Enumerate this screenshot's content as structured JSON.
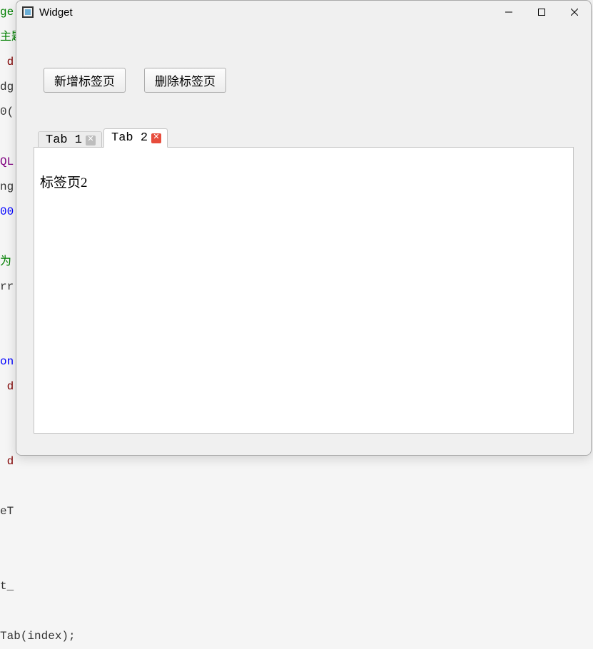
{
  "bg_code_fragments": [
    {
      "c": "g",
      "t": "ge"
    },
    {
      "c": "g",
      "t": "主题"
    },
    {
      "c": "r",
      "t": " d"
    },
    {
      "c": "",
      "t": "dg"
    },
    {
      "c": "",
      "t": "0("
    },
    {
      "c": "",
      "t": ""
    },
    {
      "c": "p",
      "t": "QL"
    },
    {
      "c": "",
      "t": "ng"
    },
    {
      "c": "b",
      "t": "00"
    },
    {
      "c": "",
      "t": ""
    },
    {
      "c": "g",
      "t": "为"
    },
    {
      "c": "",
      "t": "rr"
    },
    {
      "c": "",
      "t": ""
    },
    {
      "c": "",
      "t": ""
    },
    {
      "c": "b",
      "t": "on"
    },
    {
      "c": "r",
      "t": " d"
    },
    {
      "c": "",
      "t": ""
    },
    {
      "c": "",
      "t": ""
    },
    {
      "c": "r",
      "t": " d"
    },
    {
      "c": "",
      "t": ""
    },
    {
      "c": "",
      "t": "eT"
    },
    {
      "c": "",
      "t": ""
    },
    {
      "c": "",
      "t": ""
    },
    {
      "c": "",
      "t": "t_"
    },
    {
      "c": "",
      "t": ""
    },
    {
      "c": "",
      "t": "Tab(index);"
    }
  ],
  "window": {
    "title": "Widget",
    "buttons": {
      "add_tab": "新增标签页",
      "remove_tab": "删除标签页"
    },
    "tabs": [
      {
        "label": "Tab 1",
        "active": false
      },
      {
        "label": "Tab 2",
        "active": true
      }
    ],
    "active_tab_index": 1,
    "pane_content": "标签页2"
  }
}
